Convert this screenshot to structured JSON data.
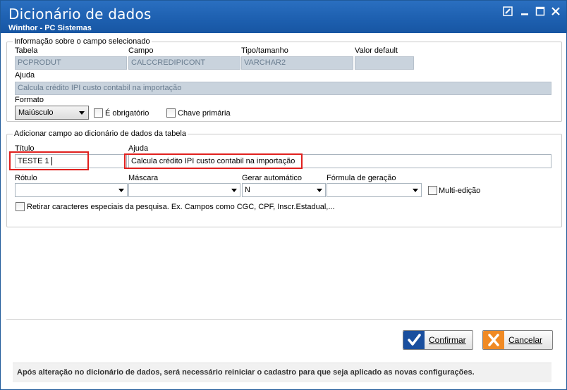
{
  "window": {
    "title": "Dicionário de dados",
    "subtitle": "Winthor - PC Sistemas"
  },
  "info_group": {
    "title": "Informação sobre o campo selecionado",
    "tabela_label": "Tabela",
    "tabela_value": "PCPRODUT",
    "campo_label": "Campo",
    "campo_value": "CALCCREDIPICONT",
    "tipo_label": "Tipo/tamanho",
    "tipo_value": "VARCHAR2",
    "valor_default_label": "Valor default",
    "valor_default_value": "",
    "ajuda_label": "Ajuda",
    "ajuda_value": "Calcula crédito IPI custo contabil na importação",
    "formato_label": "Formato",
    "formato_value": "Maiúsculo",
    "obrigatorio_label": "É obrigatório",
    "chave_primaria_label": "Chave primária"
  },
  "add_group": {
    "title": "Adicionar campo ao dicionário de dados da tabela",
    "titulo_label": "Título",
    "titulo_value": "TESTE 1",
    "ajuda_label": "Ajuda",
    "ajuda_value": "Calcula crédito IPI custo contabil na importação",
    "rotulo_label": "Rótulo",
    "rotulo_value": "",
    "mascara_label": "Máscara",
    "mascara_value": "",
    "gerar_label": "Gerar automático",
    "gerar_value": "N",
    "formula_label": "Fórmula de geração",
    "formula_value": "",
    "multi_label": "Multi-edição",
    "retirar_label": "Retirar caracteres especiais da pesquisa. Ex. Campos como CGC, CPF, Inscr.Estadual,..."
  },
  "buttons": {
    "confirmar": "Confirmar",
    "cancelar": "Cancelar"
  },
  "footer_message": "Após alteração no dicionário de dados, será necessário reiniciar o cadastro para que seja aplicado as novas configurações.",
  "colors": {
    "titlebar": "#1d5faf",
    "highlight": "#e0201e",
    "readonly_field": "#c9d3dd"
  }
}
